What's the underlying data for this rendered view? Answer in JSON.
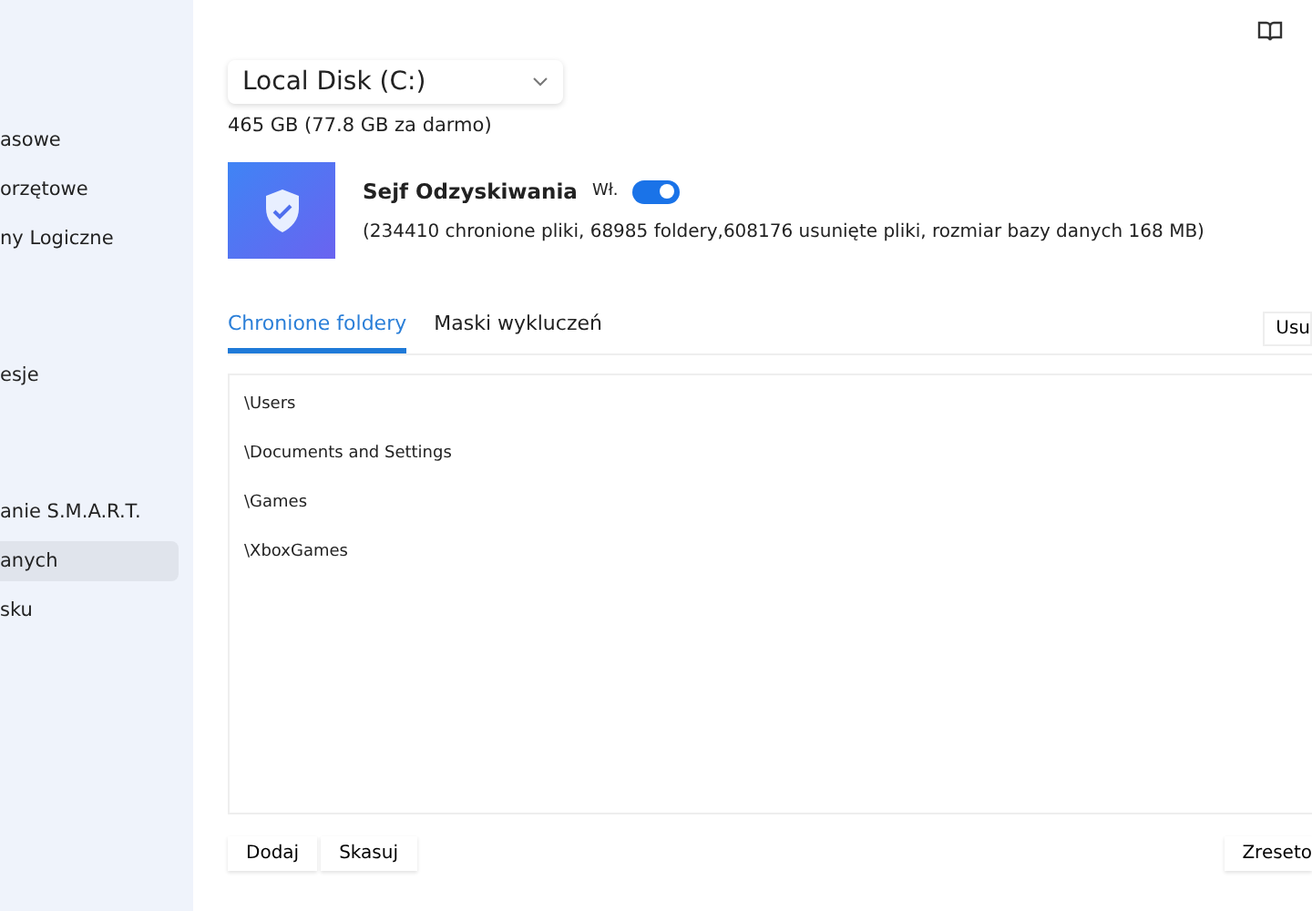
{
  "sidebar": {
    "groups": [
      {
        "items": [
          {
            "label": "asowe",
            "selected": false
          },
          {
            "label": "orzętowe",
            "selected": false
          },
          {
            "label": "ny Logiczne",
            "selected": false
          }
        ]
      },
      {
        "items": [
          {
            "label": "esje",
            "selected": false
          }
        ]
      },
      {
        "items": [
          {
            "label": "anie S.M.A.R.T.",
            "selected": false
          },
          {
            "label": "anych",
            "selected": true
          },
          {
            "label": "sku",
            "selected": false
          }
        ]
      }
    ]
  },
  "disk": {
    "value": "Local Disk (C:)",
    "info": "465 GB (77.8 GB za darmo)"
  },
  "vault": {
    "title": "Sejf Odzyskiwania",
    "toggle_label": "Wł.",
    "on": true,
    "stats": "(234410 chronione pliki, 68985 foldery,608176 usunięte pliki, rozmiar bazy danych 168 MB)"
  },
  "tabs": [
    {
      "label": "Chronione foldery",
      "selected": true
    },
    {
      "label": "Maski wykluczeń",
      "selected": false
    }
  ],
  "tab_action": "Usu",
  "folders": [
    "\\Users",
    "\\Documents and Settings",
    "\\Games",
    "\\XboxGames"
  ],
  "buttons": [
    "Dodaj",
    "Skasuj"
  ],
  "reset_button": "Zreseto"
}
